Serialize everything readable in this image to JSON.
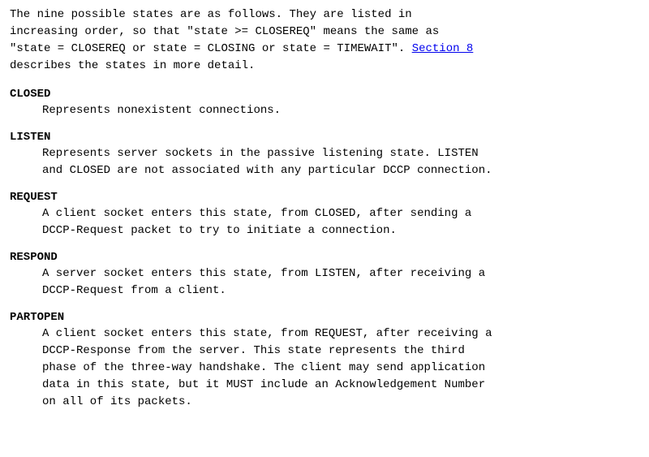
{
  "intro": {
    "line1": "The nine possible states are as follows.  They are listed in",
    "line2": "increasing order, so that \"state >= CLOSEREQ\" means the same as",
    "line3": "\"state = CLOSEREQ or state = CLOSING or state = TIMEWAIT\".",
    "link_text": "Section 8",
    "line4": "describes the states in more detail."
  },
  "states": [
    {
      "name": "CLOSED",
      "description": "Represents nonexistent connections."
    },
    {
      "name": "LISTEN",
      "description_lines": [
        "Represents server sockets in the passive listening state.  LISTEN",
        "and CLOSED are not associated with any particular DCCP connection."
      ]
    },
    {
      "name": "REQUEST",
      "description_lines": [
        "A client socket enters this state, from CLOSED, after sending a",
        "DCCP-Request packet to try to initiate a connection."
      ]
    },
    {
      "name": "RESPOND",
      "description_lines": [
        "A server socket enters this state, from LISTEN, after receiving a",
        "DCCP-Request from a client."
      ]
    },
    {
      "name": "PARTOPEN",
      "description_lines": [
        "A client socket enters this state, from REQUEST, after receiving a",
        "DCCP-Response from the server.  This state represents the third",
        "phase of the three-way handshake.  The client may send application",
        "data in this state, but it MUST include an Acknowledgement Number",
        "on all of its packets."
      ]
    }
  ]
}
